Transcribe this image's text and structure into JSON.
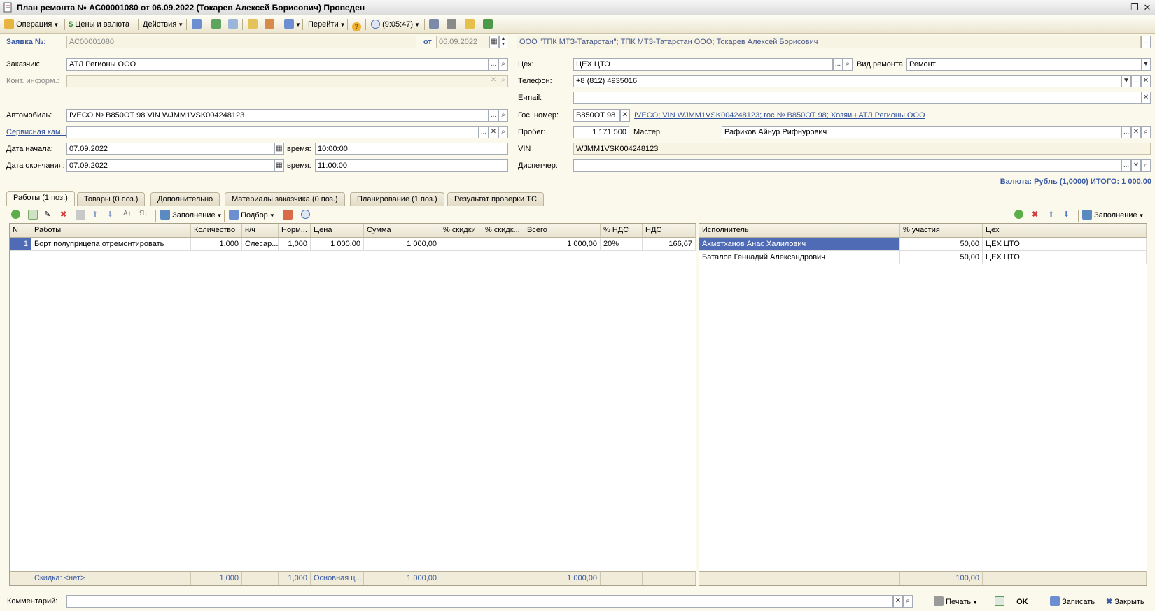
{
  "window": {
    "title": "План ремонта № АС00001080 от 06.09.2022 (Токарев Алексей Борисович) Проведен"
  },
  "toolbar": {
    "operation": "Операция",
    "prices": "Цены и валюта",
    "actions": "Действия",
    "goto": "Перейти",
    "time": "(9:05:47)"
  },
  "header": {
    "zayavka_label": "Заявка №:",
    "zayavka_value": "АС00001080",
    "ot_label": "от",
    "date": "06.09.2022",
    "org": "ООО \"ТПК МТЗ-Татарстан\"; ТПК МТЗ-Татарстан ООО; Токарев Алексей Борисович"
  },
  "form": {
    "customer_label": "Заказчик:",
    "customer": "АТЛ Регионы ООО",
    "contact_label": "Конт. информ.:",
    "car_label": "Автомобиль:",
    "car": "IVECO № В850ОТ 98 VIN WJMM1VSK004248123",
    "service_label": "Сервисная кам...",
    "start_label": "Дата начала:",
    "start_date": "07.09.2022",
    "time_label": "время:",
    "start_time": "10:00:00",
    "end_label": "Дата окончания:",
    "end_date": "07.09.2022",
    "end_time": "11:00:00",
    "shop_label": "Цех:",
    "shop": "ЦЕХ ЦТО",
    "repair_type_label": "Вид ремонта:",
    "repair_type": "Ремонт",
    "phone_label": "Телефон:",
    "phone": "+8 (812) 4935016",
    "email_label": "E-mail:",
    "plate_label": "Гос. номер:",
    "plate": "В850ОТ 98",
    "plate_link": "IVECO; VIN WJMM1VSK004248123; гос № В850ОТ 98; Хозяин АТЛ Регионы ООО",
    "mileage_label": "Пробег:",
    "mileage": "1 171 500",
    "master_label": "Мастер:",
    "master": "Рафиков Айнур Рифнурович",
    "vin_label": "VIN",
    "vin": "WJMM1VSK004248123",
    "dispatcher_label": "Диспетчер:",
    "total": "Валюта: Рубль (1,0000) ИТОГО: 1 000,00"
  },
  "tabs": [
    "Работы (1 поз.)",
    "Товары (0 поз.)",
    "Дополнительно",
    "Материалы заказчика (0 поз.)",
    "Планирование (1 поз.)",
    "Результат проверки ТС"
  ],
  "grid_toolbar": {
    "fill": "Заполнение",
    "pick": "Подбор",
    "fill_right": "Заполнение"
  },
  "works": {
    "headers": [
      "N",
      "Работы",
      "Количество",
      "н/ч",
      "Норм...",
      "Цена",
      "Сумма",
      "% скидки",
      "% скидк...",
      "Всего",
      "% НДС",
      "НДС"
    ],
    "rows": [
      [
        "1",
        "Борт полуприцепа отремонтировать",
        "1,000",
        "Слесар...",
        "1,000",
        "1 000,00",
        "1 000,00",
        "",
        "",
        "1 000,00",
        "20%",
        "166,67"
      ]
    ],
    "footer": [
      "",
      "Скидка: <нет>",
      "1,000",
      "",
      "1,000",
      "Основная ц...",
      "1 000,00",
      "",
      "",
      "1 000,00",
      "",
      ""
    ]
  },
  "executors": {
    "headers": [
      "Исполнитель",
      "% участия",
      "Цех"
    ],
    "rows": [
      [
        "Ахметханов Анас Халилович",
        "50,00",
        "ЦЕХ ЦТО"
      ],
      [
        "Баталов Геннадий Александрович",
        "50,00",
        "ЦЕХ ЦТО"
      ]
    ],
    "footer": [
      "",
      "100,00",
      ""
    ]
  },
  "bottom": {
    "comment_label": "Комментарий:",
    "print": "Печать",
    "ok": "OK",
    "save": "Записать",
    "close": "Закрыть"
  },
  "colors": {
    "accent": "#3a5aa3",
    "selection": "#4f6bb5",
    "background": "#fbf8ec"
  }
}
